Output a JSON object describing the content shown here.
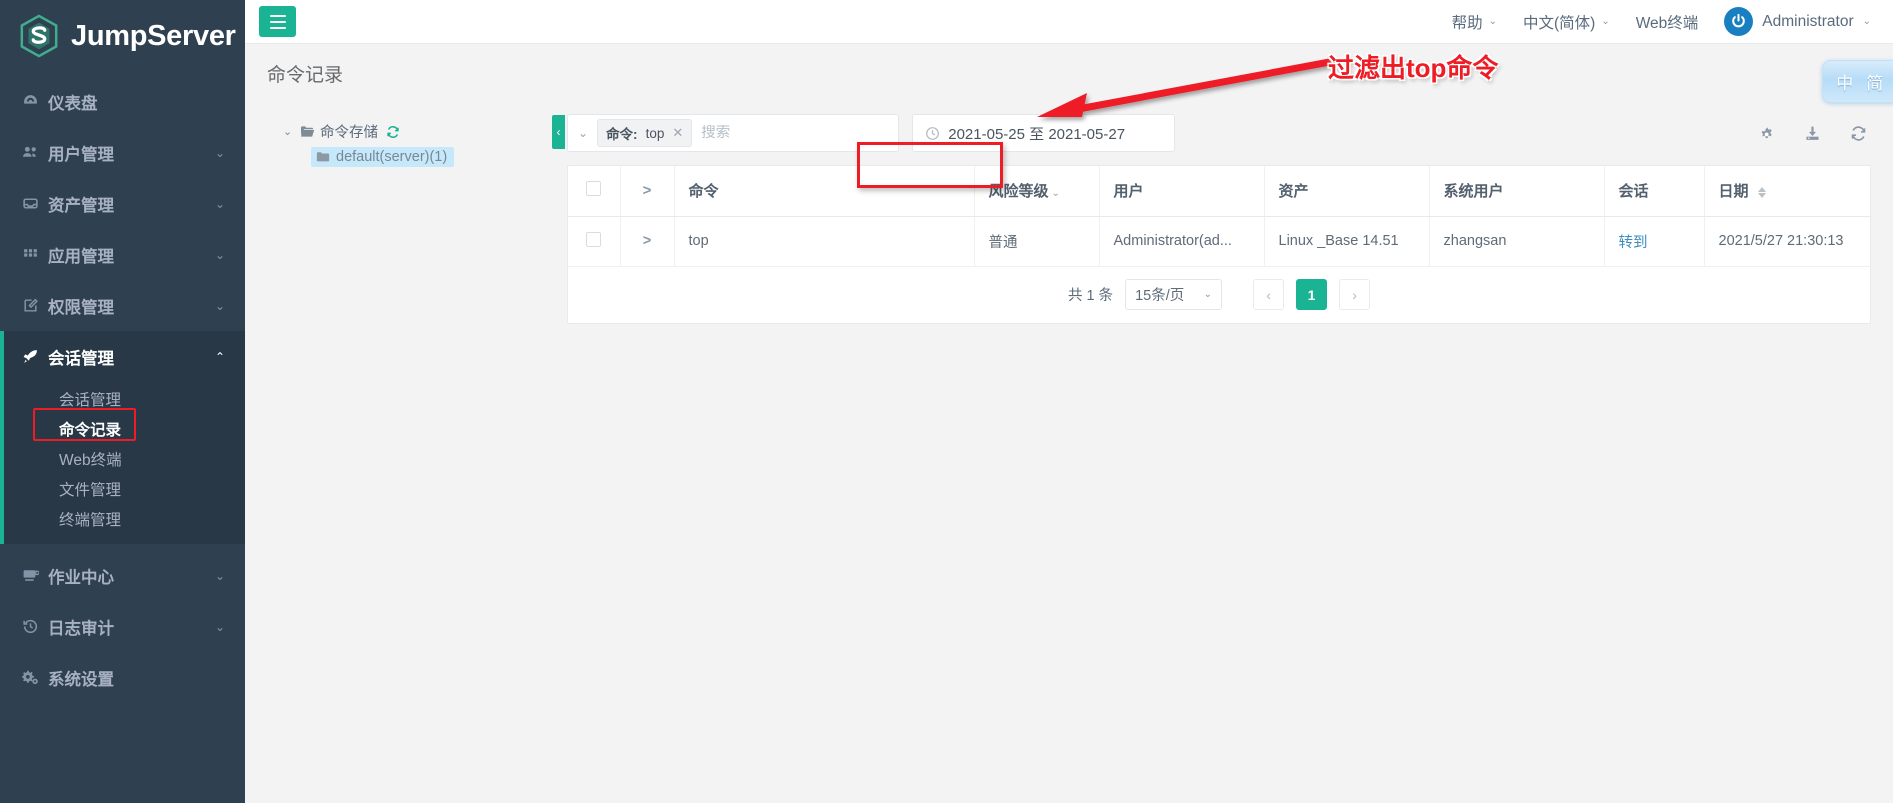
{
  "brand": {
    "name": "JumpServer",
    "logo_icon": "jumpserver-hexagon-logo"
  },
  "sidebar": {
    "items": [
      {
        "label": "仪表盘",
        "icon": "dashboard-icon",
        "has_caret": false
      },
      {
        "label": "用户管理",
        "icon": "users-icon",
        "has_caret": true
      },
      {
        "label": "资产管理",
        "icon": "assets-box-icon",
        "has_caret": true
      },
      {
        "label": "应用管理",
        "icon": "apps-grid-icon",
        "has_caret": true
      },
      {
        "label": "权限管理",
        "icon": "permission-edit-icon",
        "has_caret": true
      },
      {
        "label": "会话管理",
        "icon": "rocket-icon",
        "has_caret": true,
        "expanded": true
      },
      {
        "label": "作业中心",
        "icon": "terminal-icon",
        "has_caret": true
      },
      {
        "label": "日志审计",
        "icon": "history-icon",
        "has_caret": true
      },
      {
        "label": "系统设置",
        "icon": "settings-gears-icon",
        "has_caret": false
      }
    ],
    "submenu": [
      {
        "label": "会话管理",
        "active": false
      },
      {
        "label": "命令记录",
        "active": true
      },
      {
        "label": "Web终端",
        "active": false
      },
      {
        "label": "文件管理",
        "active": false
      },
      {
        "label": "终端管理",
        "active": false
      }
    ]
  },
  "header": {
    "menu_icon": "hamburger-icon",
    "help": "帮助",
    "language": "中文(简体)",
    "web_terminal": "Web终端",
    "user": "Administrator",
    "avatar_icon": "power-avatar-icon"
  },
  "page": {
    "title": "命令记录"
  },
  "tree": {
    "root_label": "命令存储",
    "root_icon": "folder-open-icon",
    "refresh_icon": "refresh-icon",
    "caret_icon": "chevron-down-icon",
    "child_label": "default(server)(1)",
    "child_icon": "folder-icon"
  },
  "filter": {
    "collapse_icon": "chevron-left-icon",
    "dropdown_icon": "chevron-down-icon",
    "tag_key": "命令:",
    "tag_value": "top",
    "tag_close_icon": "close-icon",
    "search_value": "",
    "search_placeholder": "搜索",
    "date_icon": "clock-icon",
    "date_range": "2021-05-25  至 2021-05-27",
    "tools": [
      {
        "icon": "gear-icon"
      },
      {
        "icon": "download-icon"
      },
      {
        "icon": "refresh-icon"
      }
    ]
  },
  "table": {
    "columns": [
      {
        "label": "",
        "type": "checkbox"
      },
      {
        "label": ">",
        "type": "expand"
      },
      {
        "label": "命令"
      },
      {
        "label": "风险等级",
        "caret": true
      },
      {
        "label": "用户"
      },
      {
        "label": "资产"
      },
      {
        "label": "系统用户"
      },
      {
        "label": "会话"
      },
      {
        "label": "日期",
        "sortable": true
      }
    ],
    "rows": [
      {
        "expand_icon": ">",
        "command": "top",
        "risk_level": "普通",
        "user": "Administrator(ad...",
        "asset": "Linux _Base 14.51",
        "system_user": "zhangsan",
        "session": "转到",
        "date": "2021/5/27 21:30:13"
      }
    ]
  },
  "pagination": {
    "total_text": "共 1 条",
    "page_size": "15条/页",
    "prev_icon": "chevron-left-icon",
    "next_icon": "chevron-right-icon",
    "current_page": "1"
  },
  "annotation": {
    "text": "过滤出top命令",
    "color": "#ee1c25"
  },
  "ime": {
    "items": [
      "中",
      "简",
      "☽",
      "👕"
    ]
  },
  "colors": {
    "accent": "#1ab394",
    "sidebar": "#2f4050",
    "link": "#3c8dbc",
    "annotation": "#ee1c25"
  }
}
